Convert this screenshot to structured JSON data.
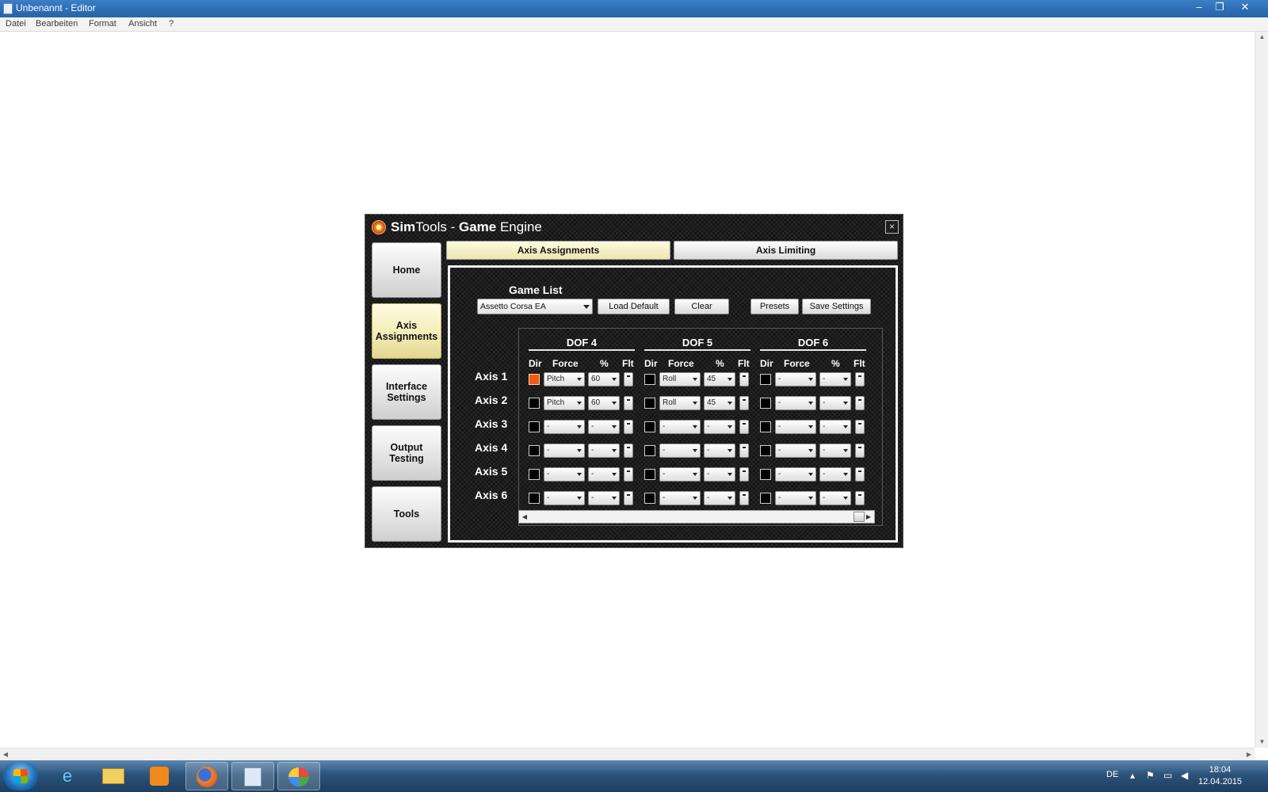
{
  "notepad": {
    "title": "Unbenannt - Editor",
    "minimize": "–",
    "restore": "❐",
    "close": "✕",
    "menu": [
      "Datei",
      "Bearbeiten",
      "Format",
      "Ansicht",
      "?"
    ]
  },
  "simtools": {
    "title_sim": "Sim",
    "title_tools": "Tools - ",
    "title_game": "Game",
    "title_engine": " Engine",
    "close": "×",
    "nav": [
      "Home",
      "Axis\nAssignments",
      "Interface\nSettings",
      "Output\nTesting",
      "Tools"
    ],
    "nav_selected": 1,
    "tabs": [
      "Axis Assignments",
      "Axis Limiting"
    ],
    "tab_selected": 0,
    "game_list_label": "Game List",
    "game_list_value": "Assetto Corsa EA",
    "buttons": {
      "load_default": "Load Default",
      "clear": "Clear",
      "presets": "Presets",
      "save_settings": "Save Settings"
    },
    "dof_headers": [
      "DOF 4",
      "DOF 5",
      "DOF 6"
    ],
    "column_headers": {
      "dir": "Dir",
      "force": "Force",
      "percent": "%",
      "flt": "Flt"
    },
    "axes": [
      {
        "label": "Axis 1",
        "cells": [
          {
            "dir": true,
            "force": "Pitch",
            "pct": "60"
          },
          {
            "dir": false,
            "force": "Roll",
            "pct": "45"
          },
          {
            "dir": false,
            "force": "-",
            "pct": "-"
          }
        ]
      },
      {
        "label": "Axis 2",
        "cells": [
          {
            "dir": false,
            "force": "Pitch",
            "pct": "60"
          },
          {
            "dir": false,
            "force": "Roll",
            "pct": "45"
          },
          {
            "dir": false,
            "force": "-",
            "pct": "-"
          }
        ]
      },
      {
        "label": "Axis 3",
        "cells": [
          {
            "dir": false,
            "force": "-",
            "pct": "-"
          },
          {
            "dir": false,
            "force": "-",
            "pct": "-"
          },
          {
            "dir": false,
            "force": "-",
            "pct": "-"
          }
        ]
      },
      {
        "label": "Axis 4",
        "cells": [
          {
            "dir": false,
            "force": "-",
            "pct": "-"
          },
          {
            "dir": false,
            "force": "-",
            "pct": "-"
          },
          {
            "dir": false,
            "force": "-",
            "pct": "-"
          }
        ]
      },
      {
        "label": "Axis 5",
        "cells": [
          {
            "dir": false,
            "force": "-",
            "pct": "-"
          },
          {
            "dir": false,
            "force": "-",
            "pct": "-"
          },
          {
            "dir": false,
            "force": "-",
            "pct": "-"
          }
        ]
      },
      {
        "label": "Axis 6",
        "cells": [
          {
            "dir": false,
            "force": "-",
            "pct": "-"
          },
          {
            "dir": false,
            "force": "-",
            "pct": "-"
          },
          {
            "dir": false,
            "force": "-",
            "pct": "-"
          }
        ]
      }
    ],
    "colors": {
      "dir_on": "#f05a14",
      "selected_button": "#f3ecb8"
    }
  },
  "taskbar": {
    "apps": [
      "internet-explorer-icon",
      "file-explorer-icon",
      "media-player-icon",
      "firefox-icon",
      "notepad-icon",
      "paint-icon"
    ],
    "language": "DE",
    "time": "18:04",
    "date": "12.04.2015"
  }
}
